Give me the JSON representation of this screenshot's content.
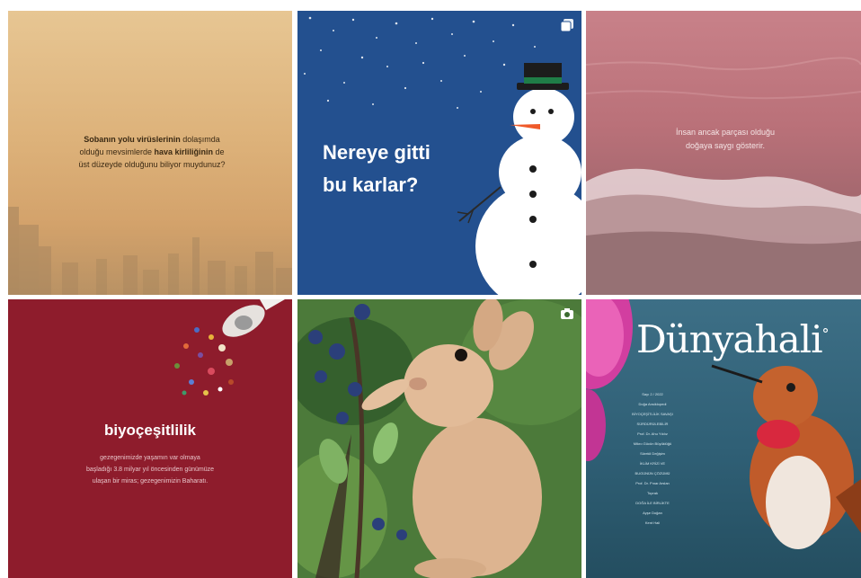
{
  "grid": {
    "posts": [
      {
        "id": "air-quality",
        "text_plain_1": "Sobanın yolu virüslerinin dolaşımda",
        "text_plain_2": "olduğu mevsimlerde ",
        "text_bold_2": "hava kirliliğinin",
        "text_plain_2b": " de",
        "text_plain_3": "üst düzeyde olduğunu biliyor muydunuz?",
        "text_bold_1": "Sobanın yolu virüslerinin"
      },
      {
        "id": "snow",
        "title_line1": "Nereye gitti",
        "title_line2": "bu karlar?",
        "badge_icon": "multiple-images-icon"
      },
      {
        "id": "sea",
        "text_line1": "İnsan ancak parçası olduğu",
        "text_line2": "doğaya saygı gösterir."
      },
      {
        "id": "biodiversity",
        "title": "biyoçeşitlilik",
        "text_line1": "gezegenimizde yaşamın var olmaya",
        "text_line2": "başladığı 3.8 milyar yıl öncesinden günümüze",
        "text_line3": "ulaşan bir miras; gezegenimizin Baharatı."
      },
      {
        "id": "bunny",
        "badge_icon": "camera-icon"
      },
      {
        "id": "magazine",
        "masthead": "Dünyahali",
        "masthead_mark": "°",
        "contents": [
          "Sayı 2 / 2022",
          "Doğa Ansiklopedi",
          "BİYOÇEŞİTLİLİK SAVAŞI",
          "SÜRDÜRÜLEBİLİR",
          "Prof. Dr. Ahu Yıldız",
          "Mikro Gücün Büyüklüğü",
          "Sürekli Değişim",
          "İKLİM KRİZİ VE",
          "BUGÜNÜN ÇÖZÜMÜ",
          "Prof. Dr. Pınar Arslan",
          "Toprak",
          "DOĞA İLE BİRLİKTE",
          "Ayşe Doğan",
          "Kent Hali"
        ]
      }
    ]
  },
  "colors": {
    "snow_blue": "#23508f",
    "wine_red": "#8e1c2c",
    "sand": "#dfb47c",
    "sea_pink": "#bb737b"
  }
}
